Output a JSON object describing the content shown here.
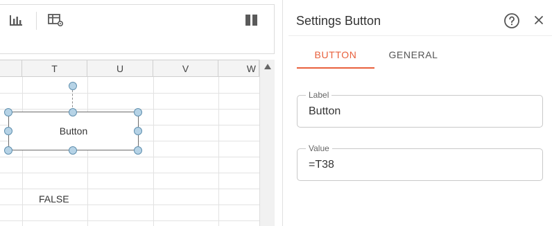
{
  "toolbar": {
    "icons": [
      "bar-chart-icon",
      "table-settings-icon",
      "panel-columns-icon"
    ]
  },
  "grid": {
    "columns": [
      "T",
      "U",
      "V",
      "W"
    ],
    "cells": {
      "false_value": "FALSE"
    },
    "widget": {
      "label": "Button"
    }
  },
  "panel": {
    "title": "Settings Button",
    "tabs": [
      {
        "label": "BUTTON",
        "active": true
      },
      {
        "label": "GENERAL",
        "active": false
      }
    ],
    "fields": {
      "label": {
        "legend": "Label",
        "value": "Button"
      },
      "value": {
        "legend": "Value",
        "value": "=T38"
      }
    }
  },
  "colors": {
    "accent": "#e8603c",
    "handle_fill": "#b6d3e6",
    "handle_stroke": "#5f8fae"
  }
}
